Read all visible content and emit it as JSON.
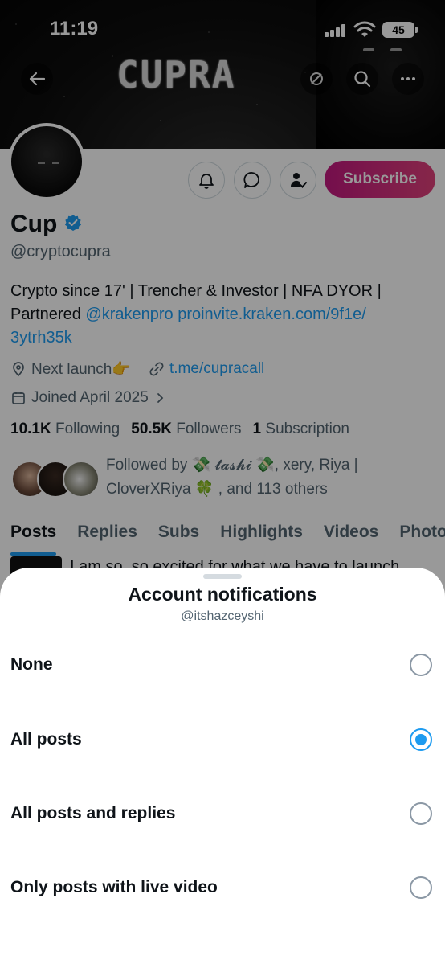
{
  "status_bar": {
    "time": "11:19",
    "battery": "45"
  },
  "banner": {
    "title": "CUPRA"
  },
  "profile": {
    "name": "Cup",
    "handle": "@cryptocupra",
    "bio_line1": "Crypto since 17' | Trencher & Investor | NFA DYOR |",
    "bio_line2_prefix": "Partnered ",
    "bio_mention": "@krakenpro",
    "bio_link": "proinvite.kraken.com/9f1e/",
    "bio_link2": "3ytrh35k",
    "location": "Next launch👉",
    "website": "t.me/cupracall",
    "joined": "Joined April 2025",
    "subscribe_label": "Subscribe",
    "following_count": "10.1K",
    "following_label": "Following",
    "followers_count": "50.5K",
    "followers_label": "Followers",
    "subscription_count": "1",
    "subscription_label": "Subscription",
    "followed_by_line1": "Followed by 💸 𝓽𝓪𝓼𝓱𝓲 💸, xery, Riya |",
    "followed_by_line2": "CloverXRiya 🍀 , and 113 others"
  },
  "tabs": [
    "Posts",
    "Replies",
    "Subs",
    "Highlights",
    "Videos",
    "Photos"
  ],
  "post_peek": "I am so, so excited for what we have to launch",
  "sheet": {
    "title": "Account notifications",
    "subtitle": "@itshazceyshi",
    "options": [
      {
        "label": "None",
        "selected": false
      },
      {
        "label": "All posts",
        "selected": true
      },
      {
        "label": "All posts and replies",
        "selected": false
      },
      {
        "label": "Only posts with live video",
        "selected": false
      }
    ]
  },
  "colors": {
    "accent": "#1d9bf0",
    "subscribe_start": "#c2187f",
    "subscribe_end": "#e0417b"
  },
  "icons": [
    "back-arrow-icon",
    "link-off-icon",
    "search-icon",
    "more-icon",
    "bell-icon",
    "message-icon",
    "user-check-icon",
    "verified-icon",
    "location-icon",
    "link-icon",
    "calendar-icon",
    "chevron-right-icon"
  ]
}
